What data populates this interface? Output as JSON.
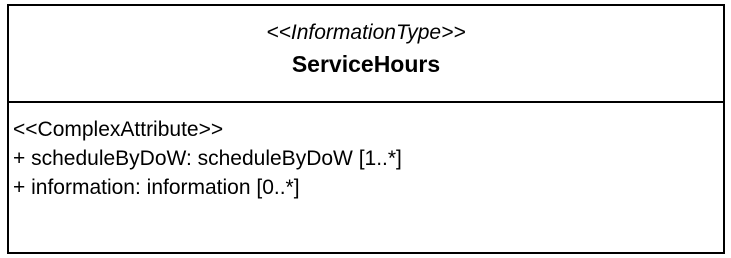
{
  "class": {
    "stereotype": "<<InformationType>>",
    "name": "ServiceHours"
  },
  "attributes": {
    "section_stereotype": "<<ComplexAttribute>>",
    "items": [
      "+ scheduleByDoW: scheduleByDoW [1..*]",
      "+ information: information [0..*]"
    ]
  }
}
